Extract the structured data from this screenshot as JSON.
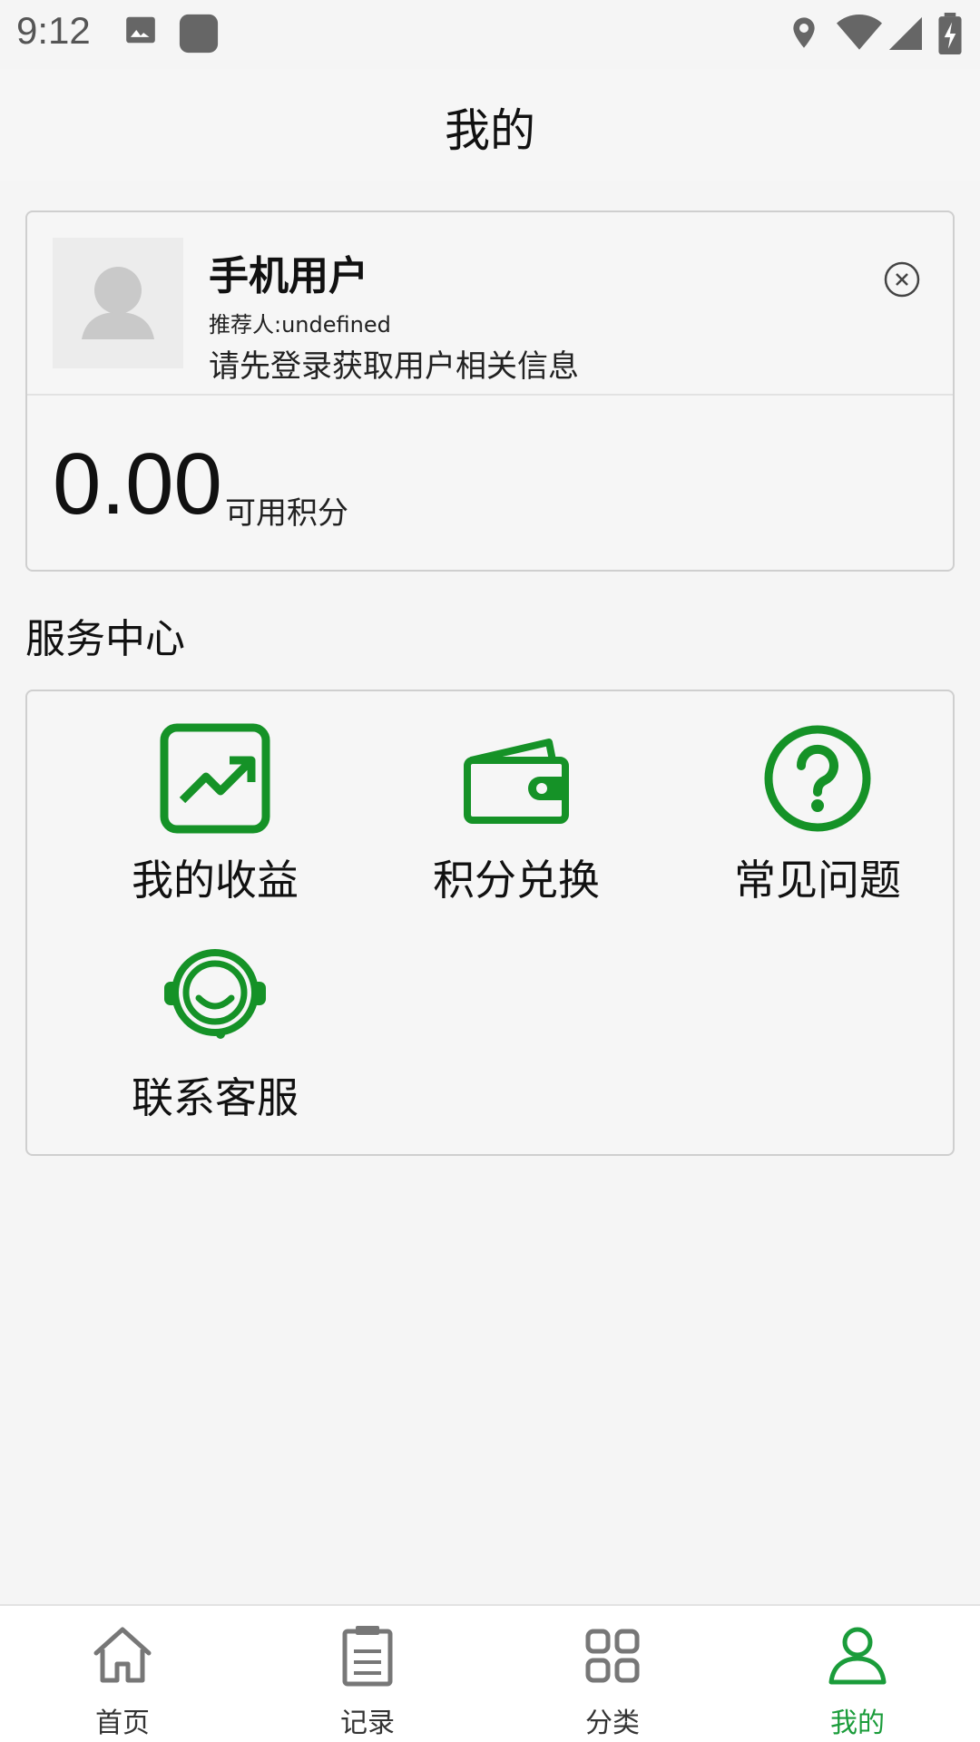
{
  "status_bar": {
    "time": "9:12"
  },
  "header": {
    "title": "我的"
  },
  "user": {
    "name": "手机用户",
    "referrer": "推荐人:undefined",
    "login_hint": "请先登录获取用户相关信息",
    "points_value": "0.00",
    "points_label": "可用积分"
  },
  "services": {
    "title": "服务中心",
    "items": [
      {
        "label": "我的收益",
        "icon": "chart-trend-icon"
      },
      {
        "label": "积分兑换",
        "icon": "wallet-icon"
      },
      {
        "label": "常见问题",
        "icon": "question-icon"
      },
      {
        "label": "联系客服",
        "icon": "headset-icon"
      }
    ]
  },
  "bottom_nav": {
    "items": [
      {
        "label": "首页",
        "icon": "home-icon"
      },
      {
        "label": "记录",
        "icon": "clipboard-icon"
      },
      {
        "label": "分类",
        "icon": "grid-icon"
      },
      {
        "label": "我的",
        "icon": "user-icon"
      }
    ],
    "active_index": 3
  },
  "colors": {
    "accent": "#1a9c3a",
    "icon_green": "#159227",
    "background": "#f5f5f5"
  }
}
